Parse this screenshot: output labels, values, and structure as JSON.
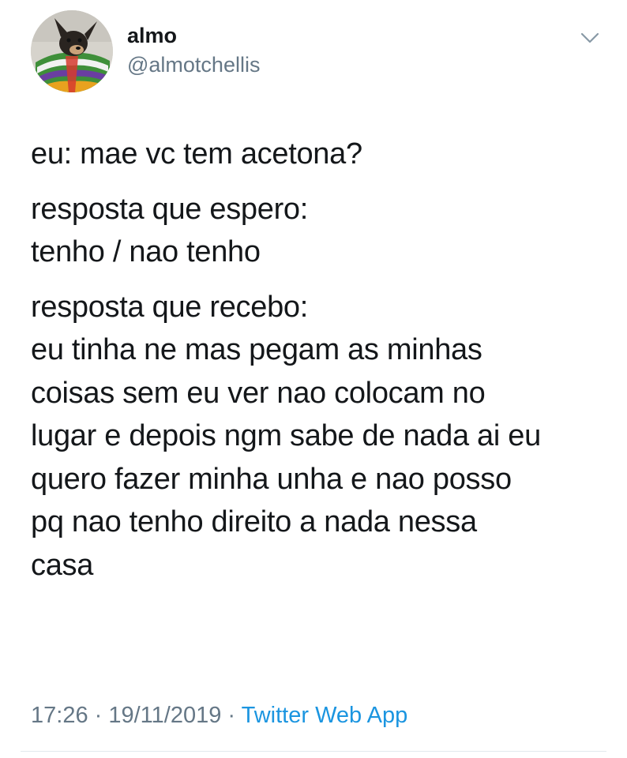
{
  "author": {
    "display_name": "almo",
    "handle": "@almotchellis",
    "avatar_icon": "dog-avatar"
  },
  "menu_icon": "chevron-down-icon",
  "tweet": {
    "paragraphs": [
      {
        "lines": [
          "eu: mae vc tem acetona?"
        ]
      },
      {
        "lines": [
          "resposta que espero:",
          "tenho / nao tenho"
        ]
      },
      {
        "lines": [
          "resposta que recebo:",
          "eu tinha ne mas pegam as minhas",
          "coisas sem eu ver nao colocam no",
          "lugar e depois ngm sabe de nada ai eu",
          "quero fazer minha unha e nao posso",
          "pq nao tenho direito a nada nessa",
          "casa"
        ]
      }
    ]
  },
  "meta": {
    "time": "17:26",
    "date": "19/11/2019",
    "separator": " · ",
    "source": "Twitter Web App"
  },
  "colors": {
    "text": "#14171a",
    "secondary": "#657786",
    "link": "#1b95e0"
  }
}
